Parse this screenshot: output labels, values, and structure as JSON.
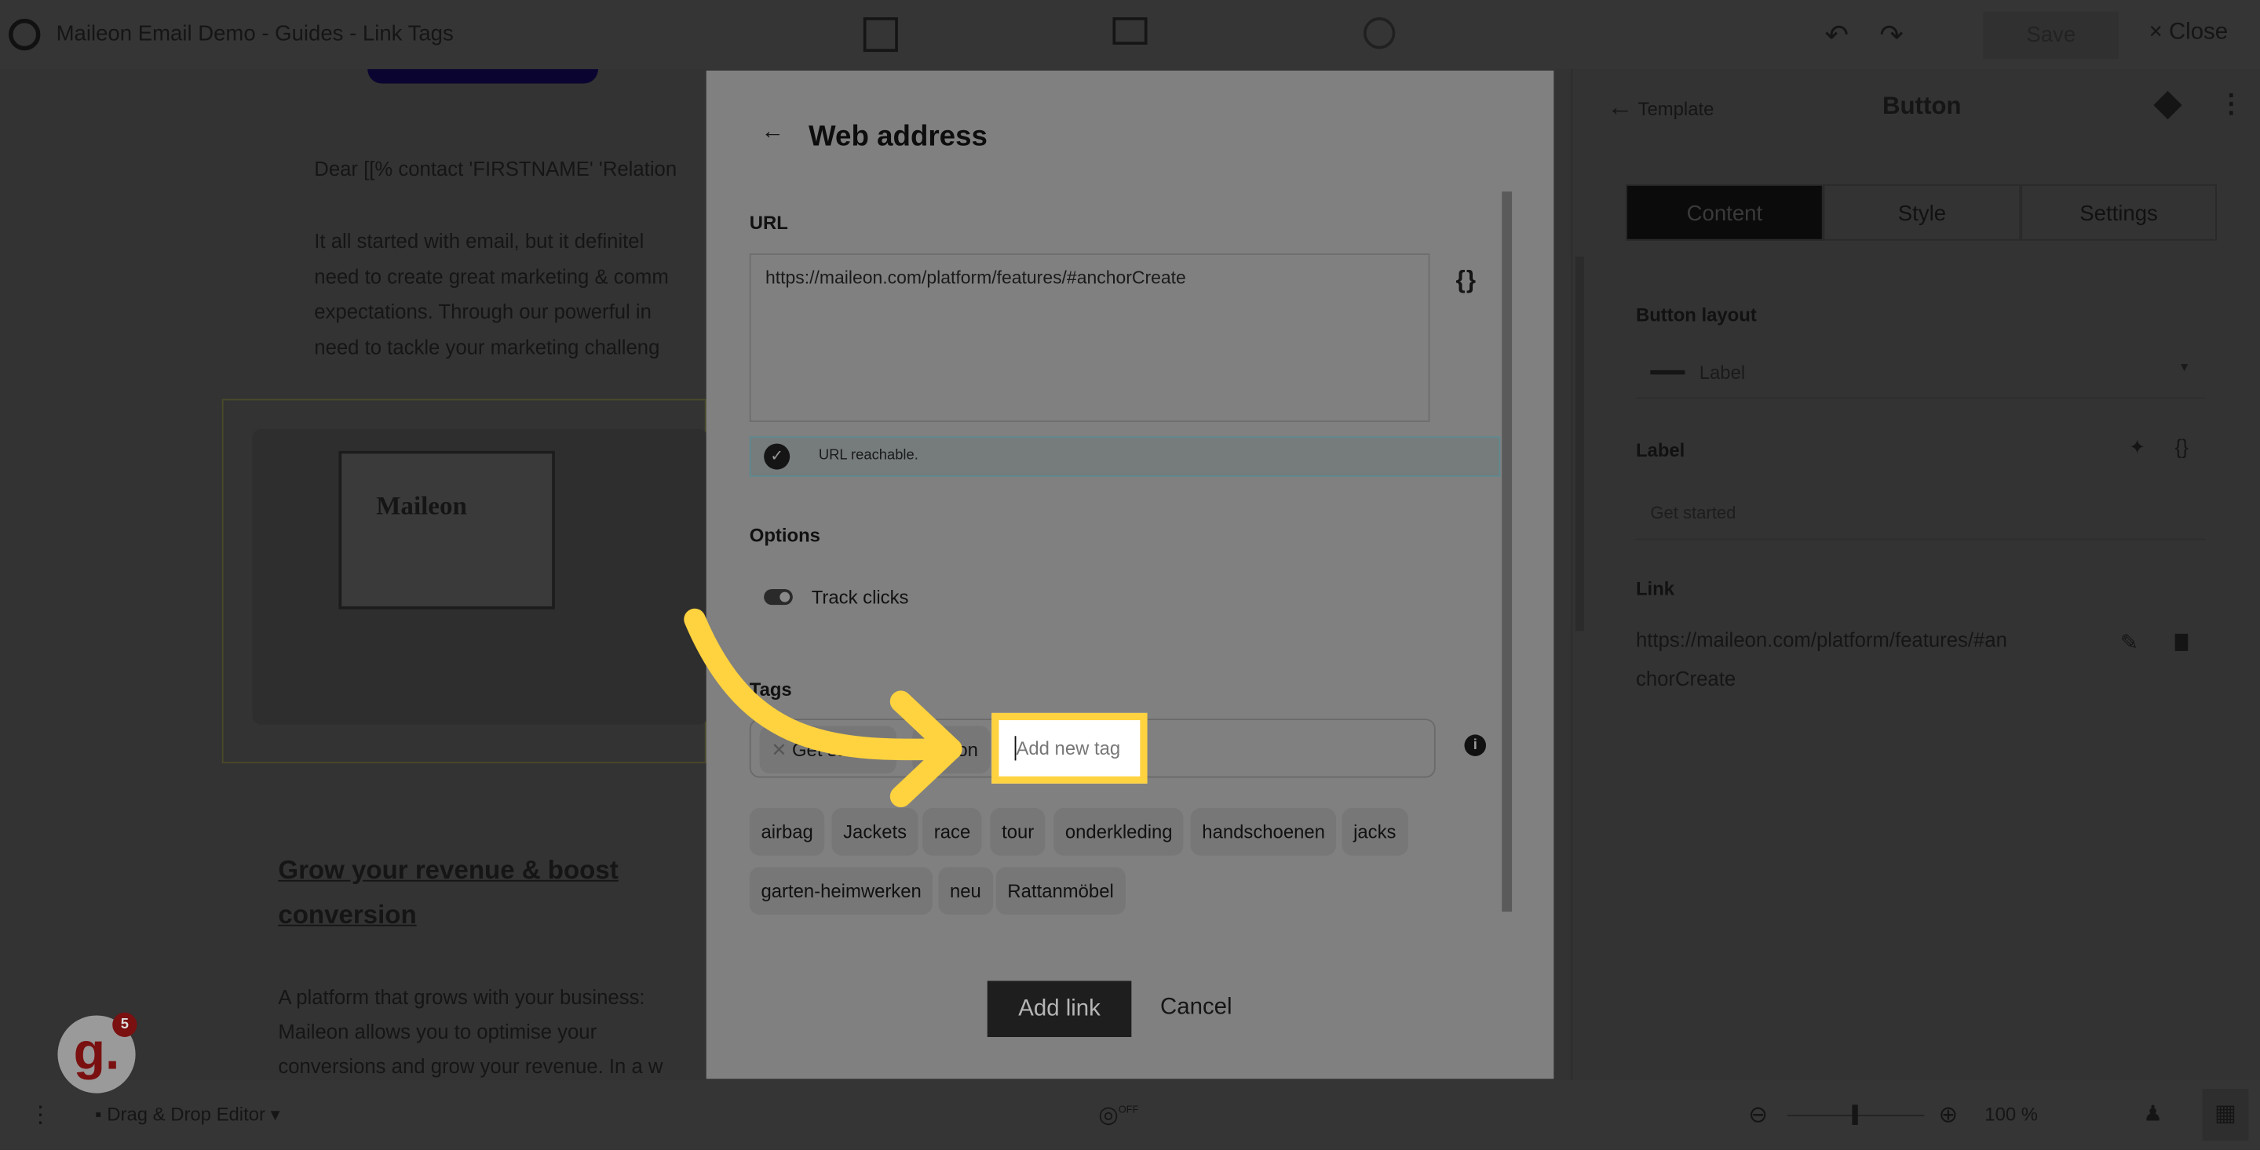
{
  "topbar": {
    "title": "Maileon Email Demo - Guides - Link Tags",
    "save": "Save",
    "close": "Close",
    "close_icon": "×"
  },
  "email": {
    "greeting": "Dear [[% contact 'FIRSTNAME' 'Relation",
    "intro_lines": [
      "It all started with email, but it definitel",
      "need to create great marketing & comm",
      "expectations. Through our powerful in",
      "need to tackle your marketing challeng"
    ],
    "heading_lines": [
      "Grow your revenue & boost",
      "conversion"
    ],
    "body_lines": [
      "A platform that grows with your business:",
      "Maileon allows you to optimise your",
      "conversions and grow your revenue. In a w"
    ],
    "image_brand": "Maileon"
  },
  "modal": {
    "title": "Web address",
    "url_label": "URL",
    "url_value": "https://maileon.com/platform/features/#anchorCreate",
    "braces_icon": "{ }",
    "url_status": "URL reachable.",
    "options_label": "Options",
    "track_clicks_label": "Track clicks",
    "track_clicks_on": true,
    "tags_label": "Tags",
    "selected_tags": [
      "Get started",
      "Button"
    ],
    "new_tag_placeholder": "Add new tag",
    "suggested_tags": [
      "airbag",
      "Jackets",
      "race",
      "tour",
      "onderkleding",
      "handschoenen",
      "jacks",
      "garten-heimwerken",
      "neu",
      "Rattanmöbel"
    ],
    "add_link": "Add link",
    "cancel": "Cancel"
  },
  "right_panel": {
    "back_label": "Template",
    "title": "Button",
    "tabs": [
      "Content",
      "Style",
      "Settings"
    ],
    "button_layout_label": "Button layout",
    "button_layout_value": "Label",
    "label_label": "Label",
    "label_value": "Get started",
    "link_label": "Link",
    "link_lines": [
      "https://maileon.com/platform/features/#an",
      "chorCreate"
    ]
  },
  "bottombar": {
    "editor": "Drag & Drop Editor",
    "toggle": "OFF",
    "zoom": "100 %"
  },
  "guide": {
    "letter": "g.",
    "badge": "5"
  },
  "colors": {
    "highlight": "#ffd23f",
    "overlay": "#333333",
    "modal": "#808080"
  }
}
